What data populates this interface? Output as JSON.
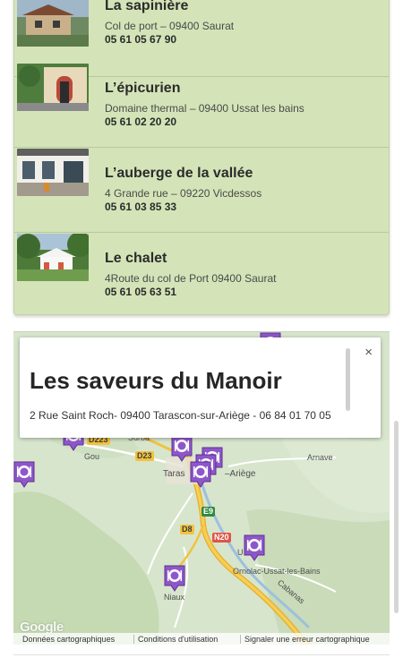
{
  "restaurants": [
    {
      "name": "La sapinière",
      "address": "Col de port – 09400 Saurat",
      "phone": "05 61 05 67 90",
      "photo": "restaurant-sapiniere-photo"
    },
    {
      "name": "L’épicurien",
      "address": "Domaine thermal – 09400 Ussat les bains",
      "phone": "05 61 02 20 20",
      "photo": "restaurant-epicurien-photo"
    },
    {
      "name": "L’auberge de la vallée",
      "address": "4 Grande rue – 09220 Vicdessos",
      "phone": "05 61 03 85 33",
      "photo": "restaurant-auberge-photo"
    },
    {
      "name": "Le chalet",
      "address": "4Route du col de Port 09400 Saurat",
      "phone": "05 61 05 63 51",
      "photo": "restaurant-chalet-photo"
    }
  ],
  "map": {
    "info_window": {
      "title": "Les saveurs du Manoir",
      "line": "2 Rue Saint Roch- 09400 Tarascon-sur-Ariège - 06 84 01 70 05",
      "close_icon": "×"
    },
    "road_labels": {
      "d223": "D223",
      "d23": "D23",
      "e9": "E9",
      "d8": "D8",
      "n20": "N20"
    },
    "places": {
      "surba": "Surba",
      "gourbit": "Gou",
      "tarascon": "Taras",
      "ariege": "–Ariège",
      "arnave": "Arnave",
      "ornolac": "Ornolac-Ussat-les-Bains",
      "niaux": "Niaux",
      "cabanas": "Cabanas",
      "u": "U"
    },
    "logo": "Google",
    "footer": {
      "data": "Données cartographiques",
      "terms": "Conditions d'utilisation",
      "report": "Signaler une erreur cartographique"
    },
    "marker_icon": "restaurant-marker-icon"
  },
  "colors": {
    "list_bg": "#d4e4b8",
    "marker": "#8e57c9",
    "highway": "#f2c23d"
  }
}
